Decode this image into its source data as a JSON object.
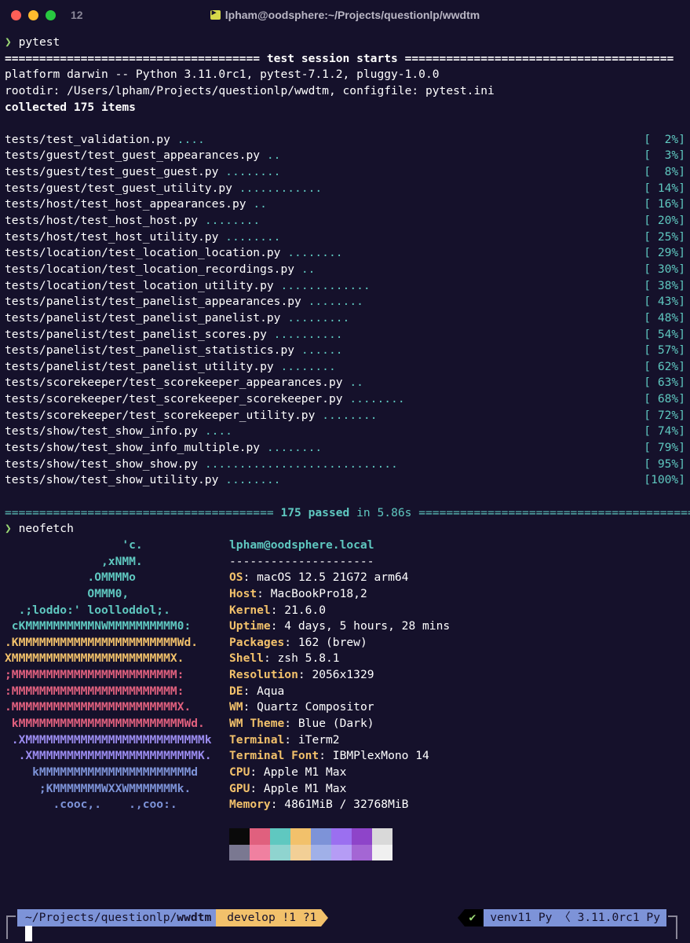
{
  "window": {
    "tab_number": "12",
    "title": "lpham@oodsphere:~/Projects/questionlp/wwdtm"
  },
  "pytest": {
    "prompt_symbol": "❯",
    "command": "pytest",
    "header_left": "=====================================",
    "header_title": "test session starts",
    "header_right": "=======================================",
    "platform": "platform darwin -- Python 3.11.0rc1, pytest-7.1.2, pluggy-1.0.0",
    "rootdir": "rootdir: /Users/lpham/Projects/questionlp/wwdtm, configfile: pytest.ini",
    "collected": "collected 175 items",
    "results": [
      {
        "file": "tests/test_validation.py",
        "dots": "....",
        "pct": "[  2%]"
      },
      {
        "file": "tests/guest/test_guest_appearances.py",
        "dots": "..",
        "pct": "[  3%]"
      },
      {
        "file": "tests/guest/test_guest_guest.py",
        "dots": "........",
        "pct": "[  8%]"
      },
      {
        "file": "tests/guest/test_guest_utility.py",
        "dots": "............",
        "pct": "[ 14%]"
      },
      {
        "file": "tests/host/test_host_appearances.py",
        "dots": "..",
        "pct": "[ 16%]"
      },
      {
        "file": "tests/host/test_host_host.py",
        "dots": "........",
        "pct": "[ 20%]"
      },
      {
        "file": "tests/host/test_host_utility.py",
        "dots": "........",
        "pct": "[ 25%]"
      },
      {
        "file": "tests/location/test_location_location.py",
        "dots": "........",
        "pct": "[ 29%]"
      },
      {
        "file": "tests/location/test_location_recordings.py",
        "dots": "..",
        "pct": "[ 30%]"
      },
      {
        "file": "tests/location/test_location_utility.py",
        "dots": ".............",
        "pct": "[ 38%]"
      },
      {
        "file": "tests/panelist/test_panelist_appearances.py",
        "dots": "........",
        "pct": "[ 43%]"
      },
      {
        "file": "tests/panelist/test_panelist_panelist.py",
        "dots": ".........",
        "pct": "[ 48%]"
      },
      {
        "file": "tests/panelist/test_panelist_scores.py",
        "dots": "..........",
        "pct": "[ 54%]"
      },
      {
        "file": "tests/panelist/test_panelist_statistics.py",
        "dots": "......",
        "pct": "[ 57%]"
      },
      {
        "file": "tests/panelist/test_panelist_utility.py",
        "dots": "........",
        "pct": "[ 62%]"
      },
      {
        "file": "tests/scorekeeper/test_scorekeeper_appearances.py",
        "dots": "..",
        "pct": "[ 63%]"
      },
      {
        "file": "tests/scorekeeper/test_scorekeeper_scorekeeper.py",
        "dots": "........",
        "pct": "[ 68%]"
      },
      {
        "file": "tests/scorekeeper/test_scorekeeper_utility.py",
        "dots": "........",
        "pct": "[ 72%]"
      },
      {
        "file": "tests/show/test_show_info.py",
        "dots": "....",
        "pct": "[ 74%]"
      },
      {
        "file": "tests/show/test_show_info_multiple.py",
        "dots": "........",
        "pct": "[ 79%]"
      },
      {
        "file": "tests/show/test_show_show.py",
        "dots": "............................",
        "pct": "[ 95%]"
      },
      {
        "file": "tests/show/test_show_utility.py",
        "dots": "........",
        "pct": "[100%]"
      }
    ],
    "footer_left": "=======================================",
    "footer_passed": "175 passed",
    "footer_time": "in 5.86s",
    "footer_right": "========================================"
  },
  "neofetch": {
    "command": "neofetch",
    "art": [
      {
        "text": "                 'c.",
        "color": "#5fc8c0"
      },
      {
        "text": "              ,xNMM.",
        "color": "#5fc8c0"
      },
      {
        "text": "            .OMMMMo",
        "color": "#5fc8c0"
      },
      {
        "text": "            OMMM0,",
        "color": "#5fc8c0"
      },
      {
        "text": "  .;loddo:' loolloddol;.",
        "color": "#5fc8c0"
      },
      {
        "text": " cKMMMMMMMMMMNWMMMMMMMMMM0:",
        "color": "#5fc8c0"
      },
      {
        "text": ".KMMMMMMMMMMMMMMMMMMMMMMMWd.",
        "color": "#f2c16b"
      },
      {
        "text": "XMMMMMMMMMMMMMMMMMMMMMMMX.",
        "color": "#f2c16b"
      },
      {
        "text": ";MMMMMMMMMMMMMMMMMMMMMMMM:",
        "color": "#e0607e"
      },
      {
        "text": ":MMMMMMMMMMMMMMMMMMMMMMMM:",
        "color": "#e0607e"
      },
      {
        "text": ".MMMMMMMMMMMMMMMMMMMMMMMMX.",
        "color": "#e0607e"
      },
      {
        "text": " kMMMMMMMMMMMMMMMMMMMMMMMMWd.",
        "color": "#e0607e"
      },
      {
        "text": " .XMMMMMMMMMMMMMMMMMMMMMMMMMMk",
        "color": "#9b8cf0"
      },
      {
        "text": "  .XMMMMMMMMMMMMMMMMMMMMMMMMK.",
        "color": "#9b8cf0"
      },
      {
        "text": "    kMMMMMMMMMMMMMMMMMMMMMMd",
        "color": "#7d93d8"
      },
      {
        "text": "     ;KMMMMMMMWXXWMMMMMMMk.",
        "color": "#7d93d8"
      },
      {
        "text": "       .cooc,.    .,coo:.",
        "color": "#7d93d8"
      }
    ],
    "user_host": "lpham@oodsphere.local",
    "separator": "---------------------",
    "info": [
      {
        "key": "OS",
        "value": ": macOS 12.5 21G72 arm64"
      },
      {
        "key": "Host",
        "value": ": MacBookPro18,2"
      },
      {
        "key": "Kernel",
        "value": ": 21.6.0"
      },
      {
        "key": "Uptime",
        "value": ": 4 days, 5 hours, 28 mins"
      },
      {
        "key": "Packages",
        "value": ": 162 (brew)"
      },
      {
        "key": "Shell",
        "value": ": zsh 5.8.1"
      },
      {
        "key": "Resolution",
        "value": ": 2056x1329"
      },
      {
        "key": "DE",
        "value": ": Aqua"
      },
      {
        "key": "WM",
        "value": ": Quartz Compositor"
      },
      {
        "key": "WM Theme",
        "value": ": Blue (Dark)"
      },
      {
        "key": "Terminal",
        "value": ": iTerm2"
      },
      {
        "key": "Terminal Font",
        "value": ": IBMPlexMono 14"
      },
      {
        "key": "CPU",
        "value": ": Apple M1 Max"
      },
      {
        "key": "GPU",
        "value": ": Apple M1 Max"
      },
      {
        "key": "Memory",
        "value": ": 4861MiB / 32768MiB"
      }
    ],
    "palette_top": [
      "#0a0a0a",
      "#e0607e",
      "#5fc8c0",
      "#f2c16b",
      "#7d93d8",
      "#9b6ff0",
      "#8e44c9",
      "#d9d9d9"
    ],
    "palette_bottom": [
      "#7a7891",
      "#f080a0",
      "#8fd4cf",
      "#f2cf96",
      "#a0b0e8",
      "#b59cf5",
      "#a466d4",
      "#f0f0f0"
    ]
  },
  "statusbar": {
    "path_prefix": "~/Projects/questionlp/",
    "path_dir": "wwdtm",
    "git": "develop !1 ?1",
    "check": "✔",
    "venv": "venv11 Py",
    "python": "3.11.0rc1 Py"
  }
}
